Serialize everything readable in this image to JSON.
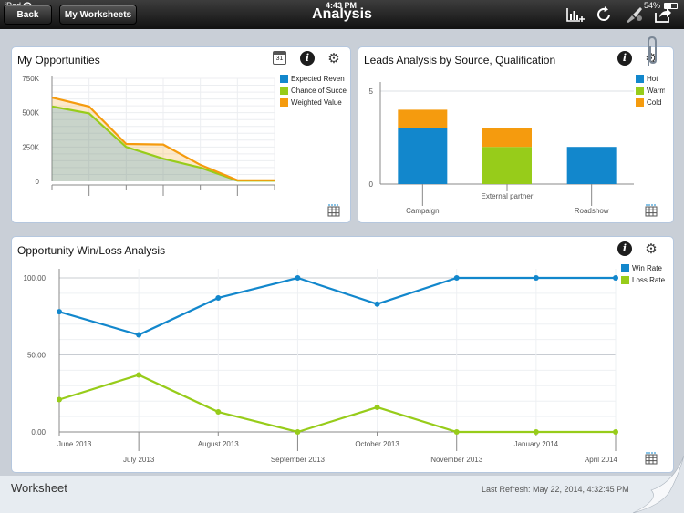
{
  "status": {
    "carrier": "iPad",
    "time": "4:43 PM",
    "battery": "54%"
  },
  "nav": {
    "back_label": "Back",
    "worksheets_label": "My Worksheets",
    "title": "Analysis"
  },
  "colors": {
    "blue": "#1287cc",
    "green": "#97cc1a",
    "orange": "#f59b0e"
  },
  "panels": {
    "opportunities": {
      "title": "My Opportunities",
      "calendar_day": "31",
      "legend": [
        "Expected Reven",
        "Chance of Succe",
        "Weighted Value"
      ]
    },
    "leads": {
      "title": "Leads Analysis by Source, Qualification",
      "legend": [
        "Hot",
        "Warm",
        "Cold"
      ]
    },
    "winloss": {
      "title": "Opportunity Win/Loss Analysis",
      "legend": [
        "Win Rate",
        "Loss Rate"
      ]
    }
  },
  "chart_data": [
    {
      "type": "area",
      "title": "My Opportunities",
      "y_ticks": [
        "750K",
        "500K",
        "250K",
        "0"
      ],
      "ylim": [
        0,
        750000
      ],
      "x_count": 7,
      "series": [
        {
          "name": "Expected Reven",
          "values": [
            610000,
            545000,
            272000,
            268000,
            120000,
            8000,
            8000
          ]
        },
        {
          "name": "Chance of Succe",
          "values": [
            545000,
            495000,
            250000,
            165000,
            100000,
            5000,
            5000
          ]
        },
        {
          "name": "Weighted Value",
          "values": [
            610000,
            545000,
            272000,
            268000,
            120000,
            8000,
            8000
          ]
        }
      ]
    },
    {
      "type": "bar",
      "title": "Leads Analysis by Source, Qualification",
      "categories": [
        "Campaign",
        "External partner",
        "Roadshow"
      ],
      "y_ticks": [
        "5",
        "0"
      ],
      "ylim": [
        0,
        5
      ],
      "series": [
        {
          "name": "Hot",
          "values": [
            3,
            0,
            2
          ]
        },
        {
          "name": "Warm",
          "values": [
            0,
            2,
            0
          ]
        },
        {
          "name": "Cold",
          "values": [
            1,
            1,
            0
          ]
        }
      ]
    },
    {
      "type": "line",
      "title": "Opportunity Win/Loss Analysis",
      "categories": [
        "June 2013",
        "July 2013",
        "August 2013",
        "September 2013",
        "October 2013",
        "November 2013",
        "January 2014",
        "April 2014"
      ],
      "y_ticks": [
        "100.00",
        "50.00",
        "0.00"
      ],
      "ylim": [
        0,
        100
      ],
      "series": [
        {
          "name": "Win Rate",
          "values": [
            78,
            63,
            87,
            100,
            83,
            100,
            100,
            100
          ]
        },
        {
          "name": "Loss Rate",
          "values": [
            21,
            37,
            13,
            0,
            16,
            0,
            0,
            0
          ]
        }
      ]
    }
  ],
  "footer": {
    "worksheet_label": "Worksheet",
    "last_refresh": "Last Refresh: May 22, 2014, 4:32:45 PM"
  }
}
